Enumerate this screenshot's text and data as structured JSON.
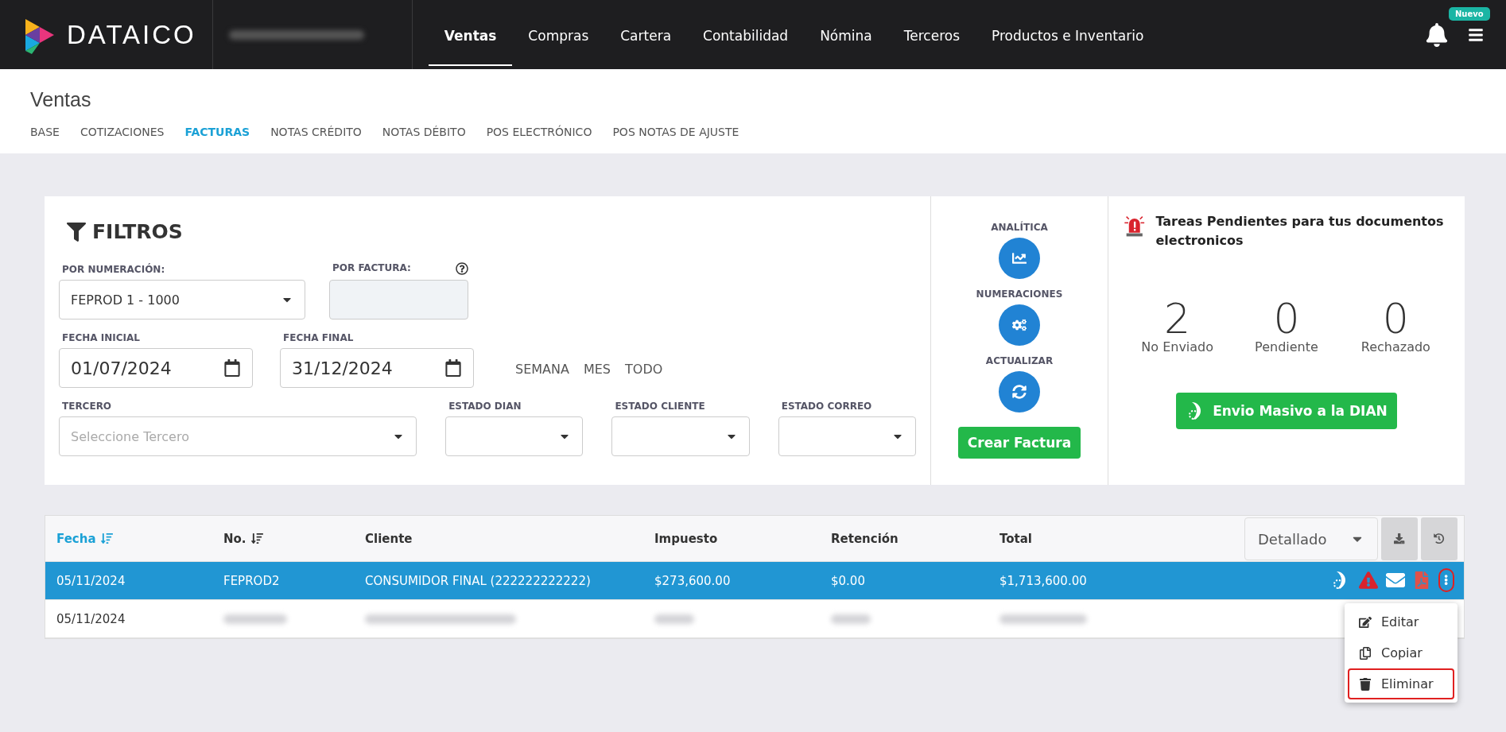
{
  "topbar": {
    "brand": "DATAICO",
    "nav": [
      {
        "label": "Ventas",
        "selected": true
      },
      {
        "label": "Compras",
        "selected": false
      },
      {
        "label": "Cartera",
        "selected": false
      },
      {
        "label": "Contabilidad",
        "selected": false
      },
      {
        "label": "Nómina",
        "selected": false
      },
      {
        "label": "Terceros",
        "selected": false
      },
      {
        "label": "Productos e Inventario",
        "selected": false
      }
    ],
    "badge": "Nuevo"
  },
  "page_title": "Ventas",
  "tabs": [
    {
      "label": "BASE",
      "selected": false
    },
    {
      "label": "COTIZACIONES",
      "selected": false
    },
    {
      "label": "FACTURAS",
      "selected": true
    },
    {
      "label": "NOTAS CRÉDITO",
      "selected": false
    },
    {
      "label": "NOTAS DÉBITO",
      "selected": false
    },
    {
      "label": "POS ELECTRÓNICO",
      "selected": false
    },
    {
      "label": "POS NOTAS DE AJUSTE",
      "selected": false
    }
  ],
  "filters": {
    "title": "FILTROS",
    "numeracion": {
      "label": "POR NUMERACIÓN:",
      "value": "FEPROD 1 - 1000"
    },
    "factura": {
      "label": "POR FACTURA:"
    },
    "fecha_inicial": {
      "label": "FECHA INICIAL",
      "value": "01/07/2024"
    },
    "fecha_final": {
      "label": "FECHA FINAL",
      "value": "31/12/2024"
    },
    "quick": [
      "SEMANA",
      "MES",
      "TODO"
    ],
    "tercero": {
      "label": "TERCERO",
      "placeholder": "Seleccione Tercero"
    },
    "estados": [
      "ESTADO DIAN",
      "ESTADO CLIENTE",
      "ESTADO CORREO"
    ]
  },
  "actions": {
    "items": [
      {
        "label": "ANALÍTICA",
        "kind": "chart"
      },
      {
        "label": "NUMERACIONES",
        "kind": "gears"
      },
      {
        "label": "ACTUALIZAR",
        "kind": "refresh"
      }
    ],
    "button": "Crear Factura"
  },
  "pending": {
    "title": "Tareas Pendientes para tus documentos electronicos",
    "counts": [
      {
        "value": "2",
        "label": "No Enviado"
      },
      {
        "value": "0",
        "label": "Pendiente"
      },
      {
        "value": "0",
        "label": "Rechazado"
      }
    ],
    "button": "Envio Masivo a la DIAN"
  },
  "table": {
    "columns": [
      {
        "label": "Fecha",
        "sorted": true
      },
      {
        "label": "No.",
        "sorted": false
      },
      {
        "label": "Cliente"
      },
      {
        "label": "Impuesto"
      },
      {
        "label": "Retención"
      },
      {
        "label": "Total"
      }
    ],
    "view": "Detallado",
    "rows": [
      {
        "selected": true,
        "cells": [
          "05/11/2024",
          "FEPROD2",
          "CONSUMIDOR FINAL (222222222222)",
          "$273,600.00",
          "$0.00",
          "$1,713,600.00"
        ],
        "more_highlighted": true
      },
      {
        "selected": false,
        "cells": [
          "05/11/2024"
        ],
        "blurred": true
      }
    ],
    "menu": [
      {
        "label": "Editar",
        "kind": "edit",
        "highlighted": false
      },
      {
        "label": "Copiar",
        "kind": "copy",
        "highlighted": false
      },
      {
        "label": "Eliminar",
        "kind": "delete",
        "highlighted": true
      }
    ]
  }
}
